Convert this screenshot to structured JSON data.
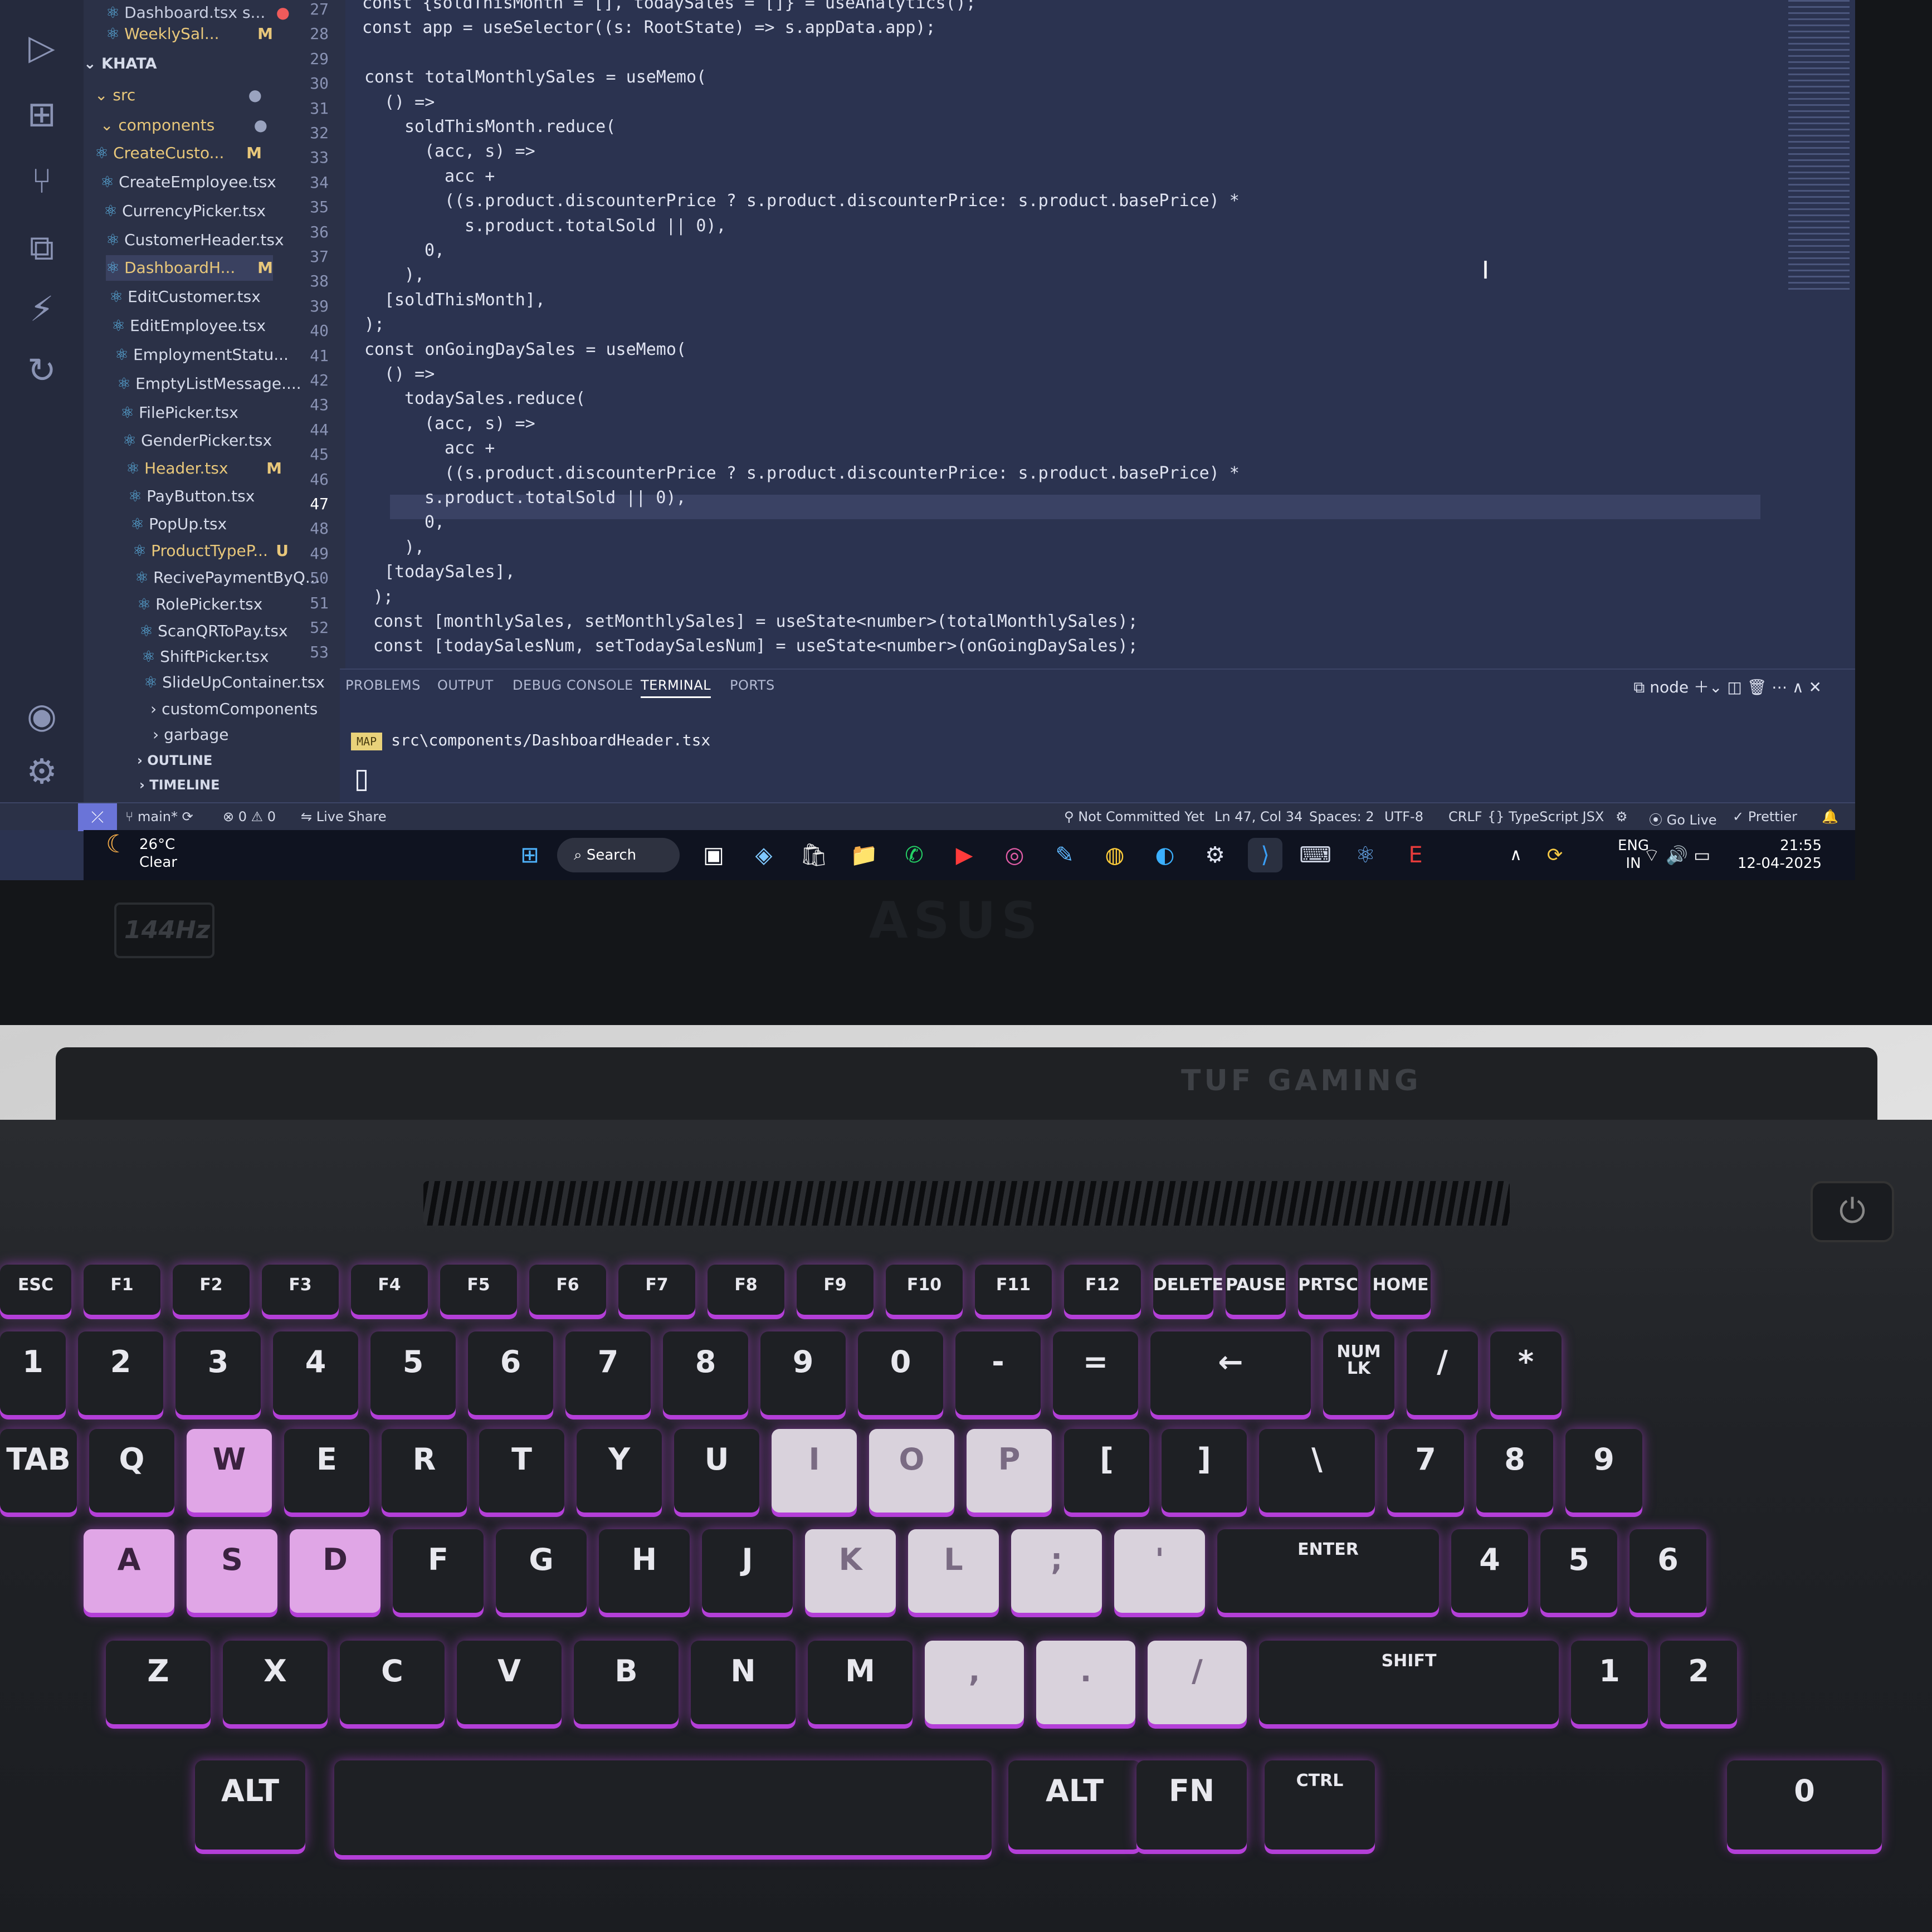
{
  "explorer": {
    "items": [
      {
        "name": "Dashboard.tsx s...",
        "status": "●",
        "kind": "file",
        "state": "error"
      },
      {
        "name": "WeeklySal...",
        "status": "M",
        "kind": "file",
        "state": "mod"
      },
      {
        "name": "KHATA",
        "status": "",
        "kind": "folder-root",
        "state": "normal"
      },
      {
        "name": "src",
        "status": "●",
        "kind": "folder",
        "state": "mod"
      },
      {
        "name": "components",
        "status": "●",
        "kind": "folder",
        "state": "mod"
      },
      {
        "name": "CreateCusto...",
        "status": "M",
        "kind": "file",
        "state": "mod"
      },
      {
        "name": "CreateEmployee.tsx",
        "status": "",
        "kind": "file",
        "state": "normal"
      },
      {
        "name": "CurrencyPicker.tsx",
        "status": "",
        "kind": "file",
        "state": "normal"
      },
      {
        "name": "CustomerHeader.tsx",
        "status": "",
        "kind": "file",
        "state": "normal"
      },
      {
        "name": "DashboardH...",
        "status": "M",
        "kind": "file",
        "state": "mod"
      },
      {
        "name": "EditCustomer.tsx",
        "status": "",
        "kind": "file",
        "state": "normal"
      },
      {
        "name": "EditEmployee.tsx",
        "status": "",
        "kind": "file",
        "state": "normal"
      },
      {
        "name": "EmploymentStatu...",
        "status": "",
        "kind": "file",
        "state": "normal"
      },
      {
        "name": "EmptyListMessage....",
        "status": "",
        "kind": "file",
        "state": "normal"
      },
      {
        "name": "FilePicker.tsx",
        "status": "",
        "kind": "file",
        "state": "normal"
      },
      {
        "name": "GenderPicker.tsx",
        "status": "",
        "kind": "file",
        "state": "normal"
      },
      {
        "name": "Header.tsx",
        "status": "M",
        "kind": "file",
        "state": "mod"
      },
      {
        "name": "PayButton.tsx",
        "status": "",
        "kind": "file",
        "state": "normal"
      },
      {
        "name": "PopUp.tsx",
        "status": "",
        "kind": "file",
        "state": "normal"
      },
      {
        "name": "ProductTypeP...",
        "status": "U",
        "kind": "file",
        "state": "untracked"
      },
      {
        "name": "RecivePaymentByQ...",
        "status": "",
        "kind": "file",
        "state": "normal"
      },
      {
        "name": "RolePicker.tsx",
        "status": "",
        "kind": "file",
        "state": "normal"
      },
      {
        "name": "ScanQRToPay.tsx",
        "status": "",
        "kind": "file",
        "state": "normal"
      },
      {
        "name": "ShiftPicker.tsx",
        "status": "",
        "kind": "file",
        "state": "normal"
      },
      {
        "name": "SlideUpContainer.tsx",
        "status": "",
        "kind": "file",
        "state": "normal"
      },
      {
        "name": "customComponents",
        "status": "",
        "kind": "folder-closed",
        "state": "normal"
      },
      {
        "name": "garbage",
        "status": "",
        "kind": "folder-closed",
        "state": "normal"
      },
      {
        "name": "OUTLINE",
        "status": "",
        "kind": "section",
        "state": "normal"
      },
      {
        "name": "TIMELINE",
        "status": "",
        "kind": "section",
        "state": "normal"
      }
    ]
  },
  "editor": {
    "line_numbers": [
      "27",
      "28",
      "29",
      "30",
      "31",
      "32",
      "33",
      "34",
      "35",
      "36",
      "37",
      "38",
      "39",
      "40",
      "41",
      "42",
      "43",
      "44",
      "45",
      "46",
      "47",
      "48",
      "49",
      "50",
      "51",
      "52",
      "53"
    ],
    "current_line": "47",
    "lines": [
      "const {soldThisMonth = [], todaySales = []} = useAnalytics();",
      "const app = useSelector((s: RootState) => s.appData.app);",
      "",
      "const totalMonthlySales = useMemo(",
      "  () =>",
      "    soldThisMonth.reduce(",
      "      (acc, s) =>",
      "        acc +",
      "        ((s.product.discounterPrice ? s.product.discounterPrice: s.product.basePrice) *",
      "          s.product.totalSold || 0),",
      "      0,",
      "    ),",
      "  [soldThisMonth],",
      ");",
      "const onGoingDaySales = useMemo(",
      "  () =>",
      "    todaySales.reduce(",
      "      (acc, s) =>",
      "        acc +",
      "        ((s.product.discounterPrice ? s.product.discounterPrice: s.product.basePrice) *",
      "        s.product.totalSold || 0),",
      "        0,",
      "      ),",
      "    [todaySales],",
      "  );",
      "  const [monthlySales, setMonthlySales] = useState<number>(totalMonthlySales);",
      "  const [todaySalesNum, setTodaySalesNum] = useState<number>(onGoingDaySales);"
    ]
  },
  "panel": {
    "tabs": [
      "PROBLEMS",
      "OUTPUT",
      "DEBUG CONSOLE",
      "TERMINAL",
      "PORTS"
    ],
    "active_tab": "TERMINAL",
    "terminal_name": "node",
    "terminal_tag": "MAP",
    "terminal_line": "src\\components/DashboardHeader.tsx"
  },
  "statusbar": {
    "branch": "main*",
    "problems": "⊗ 0 ⚠ 0",
    "live_share": "Live Share",
    "blame": "Not Committed Yet",
    "cursor": "Ln 47, Col 34",
    "spaces": "Spaces: 2",
    "encoding": "UTF-8",
    "eol": "CRLF",
    "language": "{} TypeScript JSX",
    "go_live": "Go Live",
    "prettier": "✓ Prettier"
  },
  "taskbar": {
    "weather_temp": "26°C",
    "weather_desc": "Clear",
    "search_label": "Search",
    "lang_line1": "ENG",
    "lang_line2": "IN",
    "time": "21:55",
    "date": "12-04-2025"
  },
  "hardware": {
    "bezel_logo": "ASUS",
    "bezel_badge": "144Hz",
    "deck_brand": "TUF GAMING",
    "keyboard_rows": [
      [
        "ESC",
        "F1",
        "F2",
        "F3",
        "F4",
        "F5",
        "F6",
        "F7",
        "F8",
        "F9",
        "F10",
        "F11",
        "F12",
        "DELETE",
        "PAUSE",
        "PRTSC",
        "HOME"
      ],
      [
        "1",
        "2",
        "3",
        "4",
        "5",
        "6",
        "7",
        "8",
        "9",
        "0",
        "-",
        "=",
        "←",
        "NUM LK",
        "/",
        "*"
      ],
      [
        "TAB",
        "Q",
        "W",
        "E",
        "R",
        "T",
        "Y",
        "U",
        "I",
        "O",
        "P",
        "[",
        "]",
        "\\",
        "7",
        "8",
        "9"
      ],
      [
        "A",
        "S",
        "D",
        "F",
        "G",
        "H",
        "J",
        "K",
        "L",
        ";",
        "'",
        "ENTER",
        "4",
        "5",
        "6"
      ],
      [
        "Z",
        "X",
        "C",
        "V",
        "B",
        "N",
        "M",
        ",",
        ".",
        "/",
        "SHIFT",
        "1",
        "2"
      ],
      [
        "ALT",
        "ALT",
        "FN",
        "CTRL",
        "0"
      ]
    ]
  },
  "colors": {
    "editor_bg": "#2b3350",
    "keyboard_glow": "#b43fd8",
    "modified": "#e8c77a",
    "untracked": "#86d18c"
  }
}
